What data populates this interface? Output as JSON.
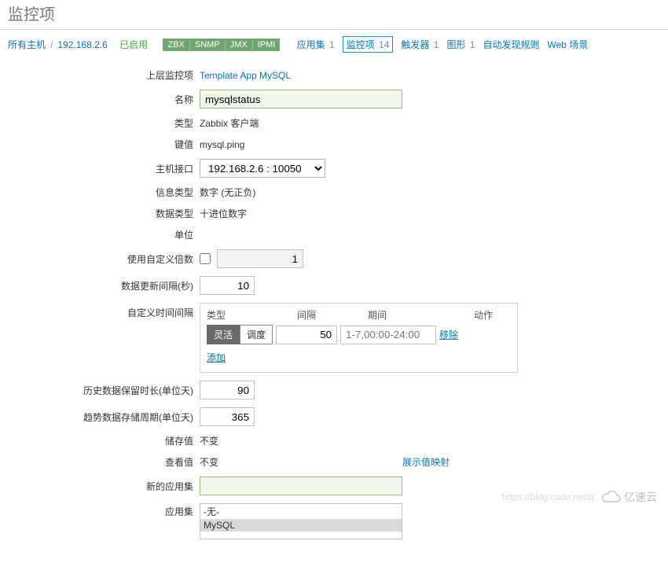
{
  "header": {
    "title": "监控项"
  },
  "breadcrumb": {
    "all_hosts": "所有主机",
    "host": "192.168.2.6",
    "status": "已启用",
    "tags": [
      "ZBX",
      "SNMP",
      "JMX",
      "IPMI"
    ],
    "tabs": {
      "apps": {
        "label": "应用集",
        "count": "1"
      },
      "items": {
        "label": "监控项",
        "count": "14"
      },
      "triggers": {
        "label": "触发器",
        "count": "1"
      },
      "graphs": {
        "label": "图形",
        "count": "1"
      },
      "discovery": {
        "label": "自动发现规则"
      },
      "web": {
        "label": "Web 场景"
      }
    }
  },
  "form": {
    "parent": {
      "label": "上层监控项",
      "value": "Template App MySQL"
    },
    "name": {
      "label": "名称",
      "value": "mysqlstatus"
    },
    "type": {
      "label": "类型",
      "value": "Zabbix 客户端"
    },
    "key": {
      "label": "键值",
      "value": "mysql.ping"
    },
    "hostif": {
      "label": "主机接口",
      "value": "192.168.2.6 : 10050"
    },
    "infotype": {
      "label": "信息类型",
      "value": "数字 (无正负)"
    },
    "datatype": {
      "label": "数据类型",
      "value": "十进位数字"
    },
    "units": {
      "label": "单位",
      "value": ""
    },
    "multiplier": {
      "label": "使用自定义倍数",
      "value": "1"
    },
    "update_interval": {
      "label": "数据更新间隔(秒)",
      "value": "10"
    },
    "custom_interval": {
      "label": "自定义时间间隔",
      "headers": {
        "type": "类型",
        "interval": "间隔",
        "period": "期间",
        "action": "动作"
      },
      "seg_active": "灵活",
      "seg_schedule": "调度",
      "interval_val": "50",
      "period_placeholder": "1-7,00:00-24:00",
      "remove": "移除",
      "add": "添加"
    },
    "history": {
      "label": "历史数据保留时长(单位天)",
      "value": "90"
    },
    "trends": {
      "label": "趋势数据存储周期(单位天)",
      "value": "365"
    },
    "store": {
      "label": "储存值",
      "value": "不变"
    },
    "show": {
      "label": "查看值",
      "value": "不变",
      "link": "展示值映射"
    },
    "new_app": {
      "label": "新的应用集",
      "value": ""
    },
    "apps": {
      "label": "应用集",
      "opt_none": "-无-",
      "opt_mysql": "MySQL"
    }
  },
  "watermark": {
    "url": "https://blog.csdn.net/q",
    "brand": "亿速云"
  }
}
